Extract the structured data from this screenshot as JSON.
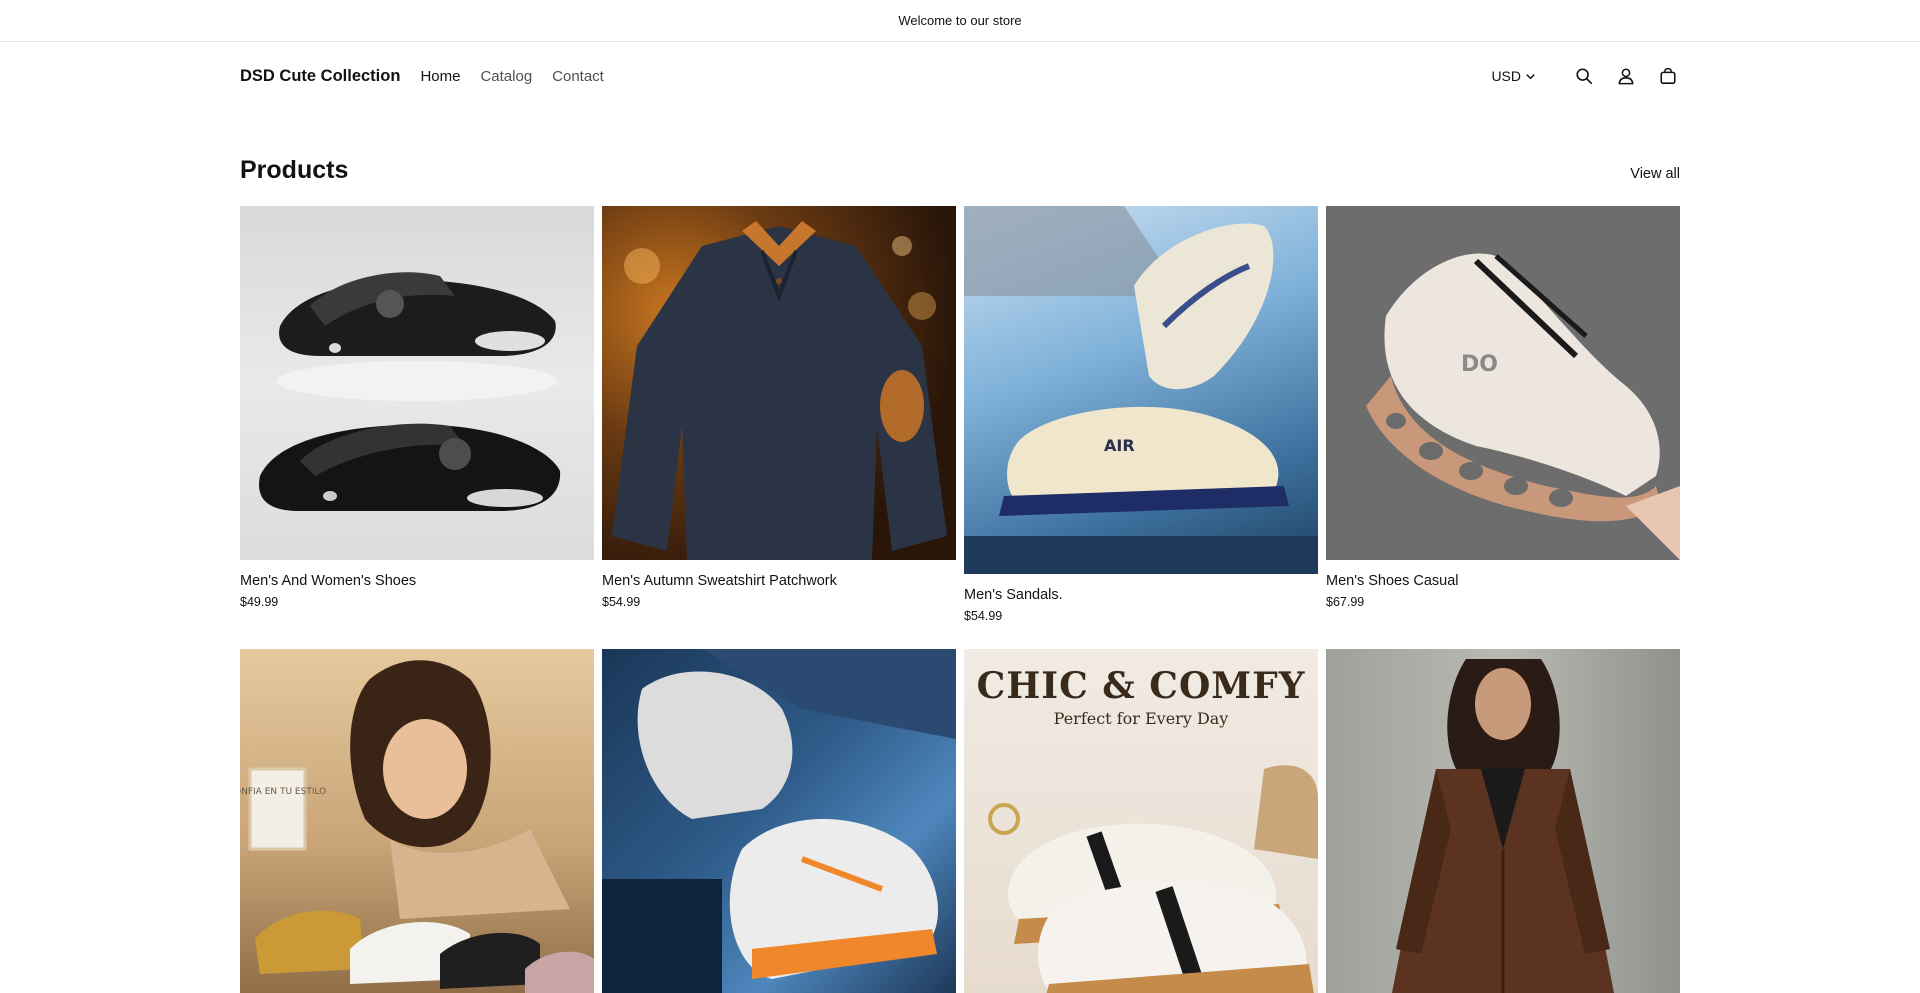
{
  "announcement": {
    "text": "Welcome to our store"
  },
  "header": {
    "logo": "DSD Cute Collection",
    "nav": [
      {
        "label": "Home"
      },
      {
        "label": "Catalog"
      },
      {
        "label": "Contact"
      }
    ],
    "currency": "USD",
    "icons": [
      "search-icon",
      "account-icon",
      "cart-icon"
    ]
  },
  "products_section": {
    "title": "Products",
    "view_all": "View all",
    "items": [
      {
        "title": "Men's And Women's Shoes",
        "price": "$49.99",
        "image": "black-clogs"
      },
      {
        "title": "Men's Autumn Sweatshirt Patchwork",
        "price": "$54.99",
        "image": "navy-sweater"
      },
      {
        "title": "Men's Sandals.",
        "price": "$54.99",
        "image": "cream-sandals"
      },
      {
        "title": "Men's Shoes Casual",
        "price": "$67.99",
        "image": "pink-running-shoe"
      },
      {
        "title": "",
        "price": "",
        "image": "woman-platform-sneakers",
        "sign_text": "CONFIA EN TU ESTILO"
      },
      {
        "title": "",
        "price": "",
        "image": "white-orange-sneaker"
      },
      {
        "title": "",
        "price": "",
        "image": "chic-comfy-shoes",
        "banner_title": "CHIC & COMFY",
        "banner_sub": "Perfect for Every Day"
      },
      {
        "title": "",
        "price": "",
        "image": "brown-coat"
      }
    ]
  },
  "colors": {
    "text": "#121212",
    "border": "#e6e6e6",
    "background": "#ffffff"
  }
}
